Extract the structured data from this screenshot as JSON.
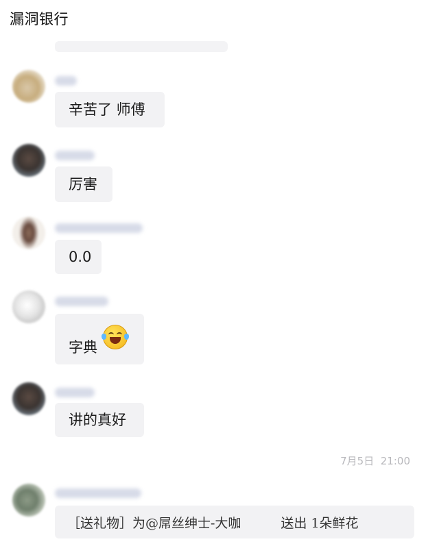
{
  "chat": {
    "title": "漏洞银行"
  },
  "messages": [
    {
      "text": "辛苦了 师傅"
    },
    {
      "text": "厉害"
    },
    {
      "text": "0.0"
    },
    {
      "text": "字典",
      "emoji": "tears-of-joy-emoji"
    },
    {
      "text": "讲的真好"
    }
  ],
  "timestamp": "7月5日  21:00",
  "gift": {
    "prefix": "［送礼物］为@屌丝绅士-大咖",
    "sent": "送出 1朵鲜花"
  }
}
